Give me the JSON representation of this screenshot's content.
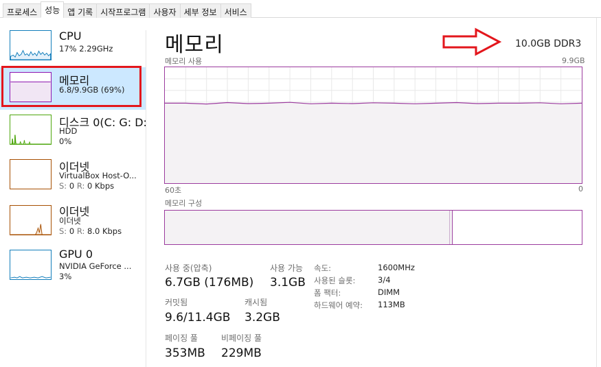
{
  "tabs": [
    {
      "label": "프로세스",
      "active": false
    },
    {
      "label": "성능",
      "active": true
    },
    {
      "label": "앱 기록",
      "active": false
    },
    {
      "label": "시작프로그램",
      "active": false
    },
    {
      "label": "사용자",
      "active": false
    },
    {
      "label": "세부 정보",
      "active": false
    },
    {
      "label": "서비스",
      "active": false
    }
  ],
  "sidebar": {
    "items": [
      {
        "title": "CPU",
        "line1": "17% 2.29GHz",
        "line2": "",
        "color": "#117dbb"
      },
      {
        "title": "메모리",
        "line1": "6.8/9.9GB (69%)",
        "line2": "",
        "color": "#8b12ae"
      },
      {
        "title": "디스크 0(C: G: D:",
        "line1": "HDD",
        "line2": "0%",
        "color": "#4da60c"
      },
      {
        "title": "이더넷",
        "line1": "VirtualBox Host-O...",
        "line2_s": "S:",
        "line2_sv": "0",
        "line2_r": "R:",
        "line2_rv": "0 Kbps",
        "color": "#a74f01"
      },
      {
        "title": "이더넷",
        "line1": "이더넷",
        "line2_s": "S:",
        "line2_sv": "0",
        "line2_r": "R:",
        "line2_rv": "8.0 Kbps",
        "color": "#a74f01"
      },
      {
        "title": "GPU 0",
        "line1": "NVIDIA GeForce ...",
        "line2": "3%",
        "color": "#117dbb"
      }
    ]
  },
  "main": {
    "title": "메모리",
    "spec": "10.0GB DDR3",
    "usage_label": "메모리 사용",
    "usage_max": "9.9GB",
    "time_left": "60초",
    "time_right": "0",
    "usage_level": 0.69,
    "composition_label": "메모리 구성",
    "composition_in_use": 0.683,
    "stats": {
      "in_use_label": "사용 중(압축)",
      "in_use_value": "6.7GB (176MB)",
      "available_label": "사용 가능",
      "available_value": "3.1GB",
      "committed_label": "커밋됨",
      "committed_value": "9.6/11.4GB",
      "cached_label": "캐시됨",
      "cached_value": "3.2GB",
      "paged_label": "페이징 풀",
      "paged_value": "353MB",
      "nonpaged_label": "비페이징 풀",
      "nonpaged_value": "229MB"
    },
    "specs": [
      {
        "key": "속도:",
        "value": "1600MHz"
      },
      {
        "key": "사용된 슬롯:",
        "value": "3/4"
      },
      {
        "key": "폼 팩터:",
        "value": "DIMM"
      },
      {
        "key": "하드웨어 예약:",
        "value": "113MB"
      }
    ]
  },
  "colors": {
    "memory": "#9b3a9e",
    "memory_fill": "#f4f2f4",
    "annotation": "#e3161c"
  }
}
